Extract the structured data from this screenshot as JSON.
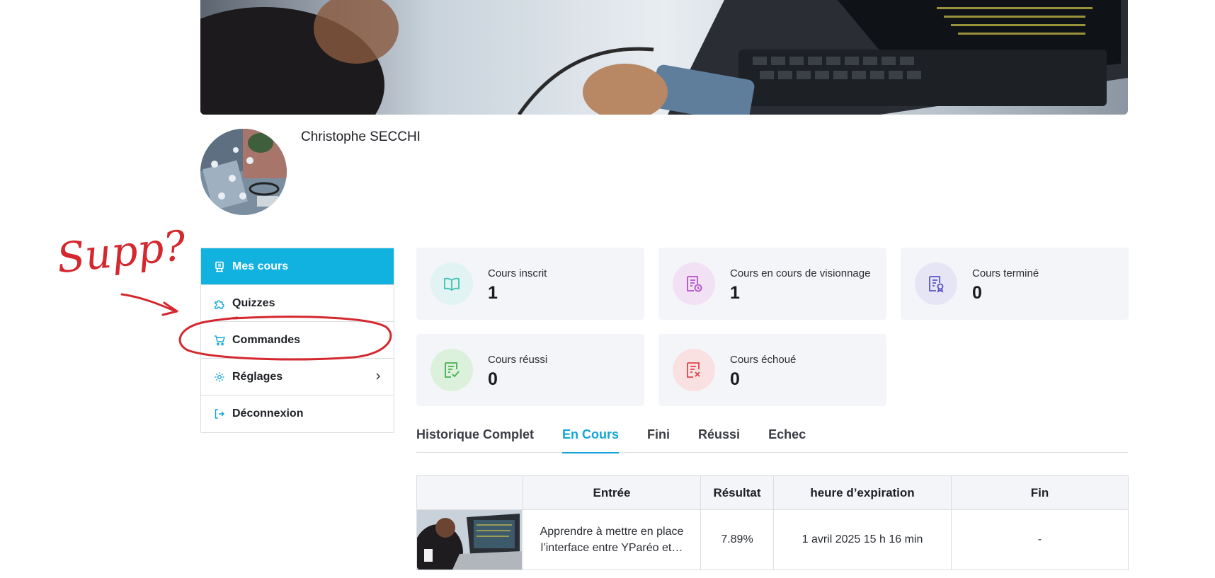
{
  "profile": {
    "name": "Christophe SECCHI"
  },
  "sidebar": {
    "items": [
      {
        "label": "Mes cours",
        "icon": "book-board-icon",
        "active": true
      },
      {
        "label": "Quizzes",
        "icon": "puzzle-icon"
      },
      {
        "label": "Commandes",
        "icon": "cart-icon"
      },
      {
        "label": "Réglages",
        "icon": "gear-icon",
        "has_submenu": true
      },
      {
        "label": "Déconnexion",
        "icon": "logout-icon"
      }
    ]
  },
  "stats": [
    {
      "label": "Cours inscrit",
      "value": "1",
      "icon": "open-book-icon",
      "color": "#3fbfb3",
      "bg": "#e1f4f3"
    },
    {
      "label": "Cours en cours de visionnage",
      "value": "1",
      "icon": "document-clock-icon",
      "color": "#b152c9",
      "bg": "#f2e1f5"
    },
    {
      "label": "Cours terminé",
      "value": "0",
      "icon": "document-award-icon",
      "color": "#5a54c4",
      "bg": "#e6e5f6"
    },
    {
      "label": "Cours réussi",
      "value": "0",
      "icon": "document-check-icon",
      "color": "#44b04b",
      "bg": "#dcf1dc"
    },
    {
      "label": "Cours échoué",
      "value": "0",
      "icon": "document-x-icon",
      "color": "#e0444c",
      "bg": "#f9e1e2"
    }
  ],
  "tabs": [
    {
      "label": "Historique Complet"
    },
    {
      "label": "En Cours",
      "active": true
    },
    {
      "label": "Fini"
    },
    {
      "label": "Réussi"
    },
    {
      "label": "Echec"
    }
  ],
  "table": {
    "headers": [
      "",
      "Entrée",
      "Résultat",
      "heure d’expiration",
      "Fin"
    ],
    "rows": [
      {
        "entry": "Apprendre à mettre en place l’interface entre YParéo et…",
        "result": "7.89%",
        "expiration": "1 avril 2025 15 h 16 min",
        "end": "-"
      }
    ]
  },
  "annotation": {
    "text": "Supp?",
    "color": "#d4282e"
  },
  "accent_color": "#11b1e0"
}
